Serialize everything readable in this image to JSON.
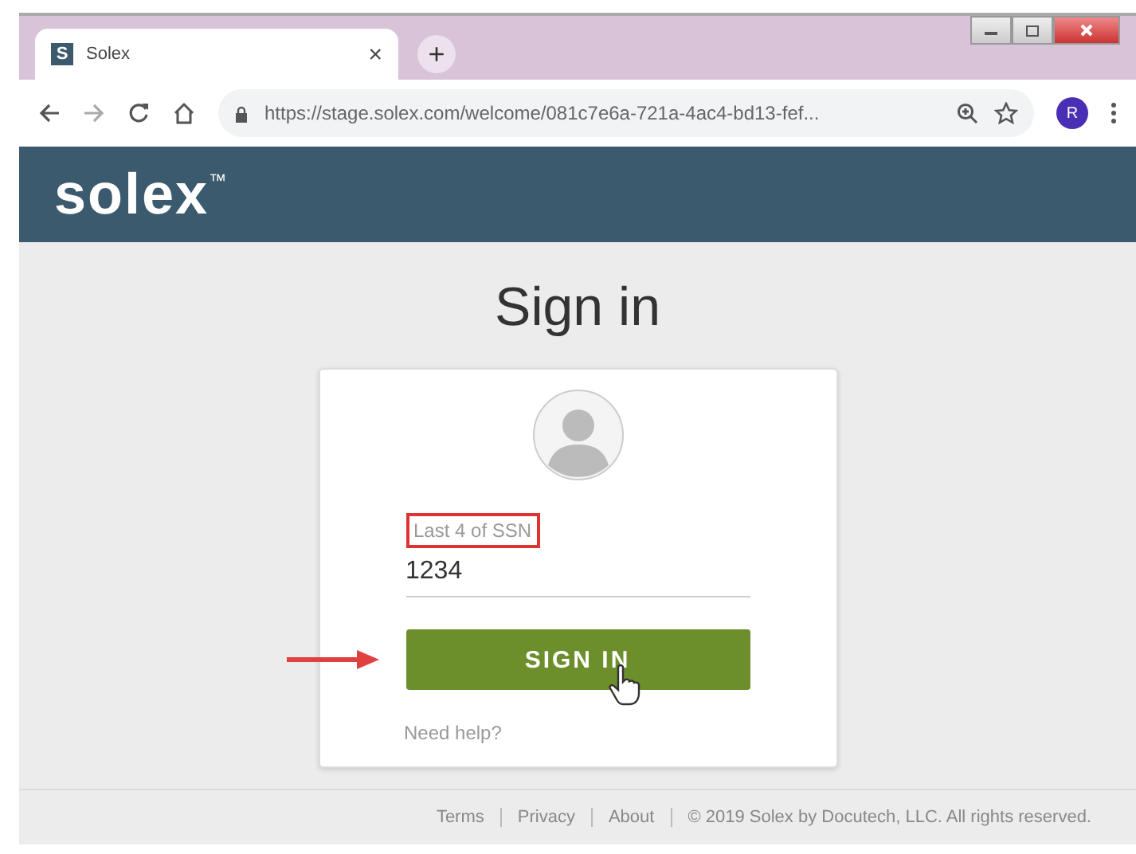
{
  "browser": {
    "tab": {
      "favicon": "S",
      "title": "Solex",
      "close": "×"
    },
    "new_tab": "+",
    "url": "https://stage.solex.com/welcome/081c7e6a-721a-4ac4-bd13-fef...",
    "profile": "R"
  },
  "header": {
    "logo": "solex",
    "trademark": "™"
  },
  "page": {
    "title": "Sign in",
    "field": {
      "label": "Last 4 of SSN",
      "value": "1234"
    },
    "button": "SIGN IN",
    "help_link": "Need help?"
  },
  "footer": {
    "links": [
      "Terms",
      "Privacy",
      "About"
    ],
    "copyright": "© 2019 Solex by Docutech, LLC. All rights reserved."
  }
}
